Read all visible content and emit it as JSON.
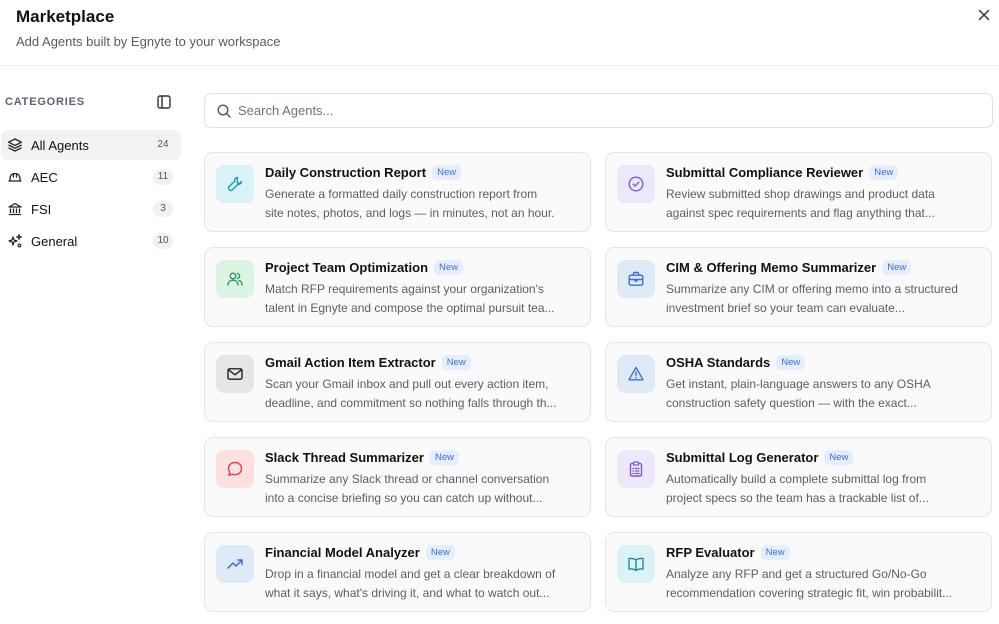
{
  "header": {
    "title": "Marketplace",
    "subtitle": "Add Agents built by Egnyte to your workspace"
  },
  "sidebar": {
    "heading": "CATEGORIES",
    "items": [
      {
        "label": "All Agents",
        "count": "24",
        "icon": "layers-icon"
      },
      {
        "label": "AEC",
        "count": "11",
        "icon": "hard-hat-icon"
      },
      {
        "label": "FSI",
        "count": "3",
        "icon": "bank-icon"
      },
      {
        "label": "General",
        "count": "10",
        "icon": "sparkles-icon"
      }
    ]
  },
  "search": {
    "placeholder": "Search Agents...",
    "value": ""
  },
  "new_label": "New",
  "agents": [
    {
      "name": "Daily Construction Report",
      "line1": "Generate a formatted daily construction report from",
      "line2": "site notes, photos, and logs — in minutes, not an hour.",
      "icon": "wrench-icon",
      "color": "#1a9bb0"
    },
    {
      "name": "Submittal Compliance Reviewer",
      "line1": "Review submitted shop drawings and product data",
      "line2": "against spec requirements and flag anything that...",
      "icon": "check-circle-icon",
      "color": "#7c5ad6"
    },
    {
      "name": "Project Team Optimization",
      "line1": "Match RFP requirements against your organization's",
      "line2": "talent in Egnyte and compose the optimal pursuit tea...",
      "icon": "users-icon",
      "color": "#2e9a5c"
    },
    {
      "name": "CIM & Offering Memo Summarizer",
      "line1": "Summarize any CIM or offering memo into a structured",
      "line2": "investment brief so your team can evaluate...",
      "icon": "briefcase-icon",
      "color": "#3b6fd8"
    },
    {
      "name": "Gmail Action Item Extractor",
      "line1": "Scan your Gmail inbox and pull out every action item,",
      "line2": "deadline, and commitment so nothing falls through th...",
      "icon": "mail-icon",
      "color": "#222222"
    },
    {
      "name": "OSHA Standards",
      "line1": "Get instant, plain-language answers to any OSHA",
      "line2": "construction safety question — with the exact...",
      "icon": "warning-icon",
      "color": "#3b6fd8"
    },
    {
      "name": "Slack Thread Summarizer",
      "line1": "Summarize any Slack thread or channel conversation",
      "line2": "into a concise briefing so you can catch up without...",
      "icon": "chat-bubble-icon",
      "color": "#e0414b"
    },
    {
      "name": "Submittal Log Generator",
      "line1": "Automatically build a complete submittal log from",
      "line2": "project specs so the team has a trackable list of...",
      "icon": "clipboard-list-icon",
      "color": "#7c5ad6"
    },
    {
      "name": "Financial Model Analyzer",
      "line1": "Drop in a financial model and get a clear breakdown of",
      "line2": "what it says, what's driving it, and what to watch out...",
      "icon": "trending-up-icon",
      "color": "#3b6fd8"
    },
    {
      "name": "RFP Evaluator",
      "line1": "Analyze any RFP and get a structured Go/No-Go",
      "line2": "recommendation covering strategic fit, win probabilit...",
      "icon": "open-book-icon",
      "color": "#1a8aa0"
    }
  ]
}
